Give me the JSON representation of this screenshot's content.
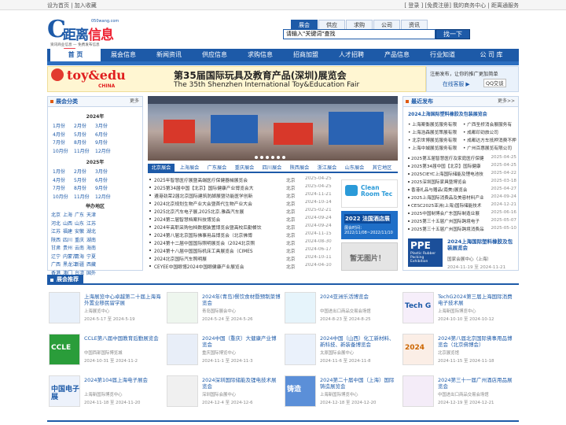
{
  "top": {
    "left": "设为首页 | 加入收藏",
    "right": "[ 登录 ] [免费注册]  我的商务中心 | 距离通服务"
  },
  "logo": {
    "char": "C",
    "title_a": "距离",
    "title_b": "信息网",
    "domain": "050wang.com",
    "slogan": "资讯商业信息 — 免费发布信息"
  },
  "search": {
    "tabs": [
      "展会",
      "供应",
      "求购",
      "公司",
      "资讯"
    ],
    "placeholder": "请输入\"关键词\"查找",
    "button": "找一下"
  },
  "nav": [
    "首 页",
    "展会信息",
    "新闻资讯",
    "供应信息",
    "求购信息",
    "招商加盟",
    "人才招聘",
    "产品信息",
    "行业知道",
    "公 司 库"
  ],
  "banner": {
    "logo_a": "toy&edu",
    "logo_b": "CHINA",
    "cn": "第35届国际玩具及教育产品(深圳)展览会",
    "en": "The 35th Shenzhen International Toy&Education Fair"
  },
  "reg": {
    "text": "注册发布，让你的推广更加简单",
    "link": "在线客服 ▶",
    "qq": "QQ交谈"
  },
  "category": {
    "title": "展会分类",
    "more": "更多",
    "y2024": "2024年",
    "months2024": [
      "1月份",
      "2月份",
      "3月份",
      "4月份",
      "5月份",
      "6月份",
      "7月份",
      "8月份",
      "9月份",
      "10月份",
      "11月份",
      "12月份"
    ],
    "y2025": "2025年",
    "months2025": [
      "1月份",
      "2月份",
      "3月份",
      "4月份",
      "5月份",
      "6月份",
      "7月份",
      "8月份",
      "9月份",
      "10月份",
      "11月份",
      "12月份"
    ],
    "region_title": "举办地区",
    "regions": [
      "北京",
      "上海",
      "广东",
      "天津",
      "河北",
      "山西",
      "山东",
      "江苏",
      "江苏",
      "福建",
      "安徽",
      "湖北",
      "陕西",
      "四川",
      "重庆",
      "湖南",
      "甘肃",
      "贵州",
      "云南",
      "海南",
      "辽宁",
      "内蒙古",
      "青海",
      "宁夏",
      "广西",
      "黑龙江",
      "新疆",
      "西藏",
      "香港",
      "澳门",
      "台湾",
      "国外"
    ]
  },
  "region_tabs": [
    "北京展会",
    "上海展会",
    "广东展会",
    "重庆展会",
    "四川展会",
    "陕西展会",
    "浙江展会",
    "山东展会",
    "其它地区"
  ],
  "list": [
    {
      "n": "2025年智慧医疗展暨高端医疗保健器械展览会",
      "c": "北京",
      "d": "2025-04-25"
    },
    {
      "n": "2025第34届中国【北京】国际健康产业博览会大",
      "c": "北京",
      "d": "2025-04-25"
    },
    {
      "n": "遵港劲荣2届北京国际建筑防脚展暨功能医学创新",
      "c": "北京",
      "d": "2024-11-21"
    },
    {
      "n": "2024北京规划生物产业大会暨首代生物产业大会",
      "c": "北京",
      "d": "2024-10-14"
    },
    {
      "n": "2025北京汽车电子展,2025北京.雅森汽车展",
      "c": "北京",
      "d": "2025-02-21"
    },
    {
      "n": "2024第二届智慧档案科技博览会",
      "c": "北京",
      "d": "2024-09-24"
    },
    {
      "n": "2024年高职采购包档数据装置博览会暨高校后勤餐饮",
      "c": "北京",
      "d": "2024-09-24"
    },
    {
      "n": "2024第八届北京国际佛事用品博览会（北京佛博",
      "c": "北京",
      "d": "2024-11-15"
    },
    {
      "n": "2024第十二届中国国际照明展览会（2024北京照",
      "c": "北京",
      "d": "2024-08-30"
    },
    {
      "n": "2024第十八届中国国际机床工具展览会（CIMES",
      "c": "北京",
      "d": "2024-06-17"
    },
    {
      "n": "2024北京国际汽车照明展",
      "c": "北京",
      "d": "2024-10-11"
    },
    {
      "n": "CEYEE中国眼博2024中国眼健康产业展览会",
      "c": "北京",
      "d": "2024-04-10"
    }
  ],
  "ads": {
    "ad1": "Clean Room Tec",
    "ad2_title": "2022 法国酒店展",
    "ad2_date": "展会时间：2022/11/08~2022/11/10",
    "ad3": "暂无图片！"
  },
  "latest": {
    "title": "最近发布",
    "more": "更多>>",
    "sub": "2024上海国际塑料橡胶及包装展览会",
    "grid": [
      "上海案衡展览服务有限",
      "广西圣桥消会展服务有",
      "上海浩森展览策展有限",
      "成都印劲旅公司",
      "北京世博展览服务有限",
      "成都达方车抵押消费不押",
      "上海中城展览服务有限",
      "广州百惠展览有限公司"
    ],
    "rows": [
      {
        "n": "2025第五届智慧医疗及家庭医疗保健",
        "d": "2025-04-25"
      },
      {
        "n": "2025第34届中国【北京】国际健康",
        "d": "2025-04-25"
      },
      {
        "n": "2025CIEYC上海国际储能及锂电池技",
        "d": "2025-04-22"
      },
      {
        "n": "2025深圳国际家具暨博览会",
        "d": "2025-03-18"
      },
      {
        "n": "香港礼品与赠品(南美)展览会",
        "d": "2025-04-27"
      },
      {
        "n": "2025上海国际消费品及美容材料产业",
        "d": "2024-09-24"
      },
      {
        "n": "CESC2025亚洲(上海)国际储能技术",
        "d": "2024-12-21"
      },
      {
        "n": "2025中国制博会广东国际制造业展",
        "d": "2025-06-16"
      },
      {
        "n": "2025第三十五届广州国际跨境电子",
        "d": "2025-05-07"
      },
      {
        "n": "2025第三十五届广州国际跨境消费品",
        "d": "2025-05-10"
      }
    ],
    "ppe_a": "PPE",
    "ppe_b": "Plastic Rubber Packing Exhibition",
    "pt": "2024上海国际塑料橡胶及包装展览会",
    "pc": "国家会展中心（上海）",
    "pd": "2024-11-19 至 2024-11-21"
  },
  "rec_title": "展会推荐",
  "cards": [
    {
      "lab": "",
      "t": "上海展览中心卓越第二十届上海海外置业移民留学展",
      "c": "上海展览中心",
      "d": "2024-5-17  至  2024-5-19"
    },
    {
      "lab": "",
      "t": "2024年(青岛)餐饮食材暨预制菜博览会",
      "c": "青岛国际展会中心",
      "d": "2024-5-24  至  2024-5-26"
    },
    {
      "lab": "",
      "t": "2024亚洲乐活博览会",
      "c": "中国进出口商品交易会场馆",
      "d": "2024-8-23  至  2024-8-25"
    },
    {
      "lab": "Tech G",
      "t": "TechG2024第三届上海国际消费电子技术展",
      "c": "上海新国际博览中心",
      "d": "2024-10-10  至  2024-10-12"
    },
    {
      "lab": "CCLE",
      "t": "CCLE第八届中国教育后勤展览会",
      "c": "中国西部国际博览城",
      "d": "2024-10-31  至  2024-11-2"
    },
    {
      "lab": "",
      "t": "2024中国（重庆）大健康产业博览会",
      "c": "重庆国际博览中心",
      "d": "2024-11-1  至  2024-11-3"
    },
    {
      "lab": "",
      "t": "2024中国（山西）化工新材料、新科技、新装备博览会",
      "c": "太原国际会展中心",
      "d": "2024-11-6  至  2024-11-8"
    },
    {
      "lab": "2024",
      "t": "2024第八届北京国际佛事用品博览会（北京佛博会）",
      "c": "北京展览馆",
      "d": "2024-11-15  至  2024-11-18"
    },
    {
      "lab": "中国电子展",
      "t": "2024第104届上海电子展会",
      "c": "上海新国际博览中心",
      "d": "2024-11-18  至  2024-11-20"
    },
    {
      "lab": "",
      "t": "2024深圳国际储能及锂电技术展览会",
      "c": "深圳国际会展中心",
      "d": "2024-12-4  至  2024-12-6"
    },
    {
      "lab": "铸造",
      "t": "2024第二十届中国（上海）国际铸造展览会",
      "c": "上海新国际博览中心",
      "d": "2024-12-18  至  2024-12-20"
    },
    {
      "lab": "",
      "t": "2024第三十一届广州酒店用品展览会",
      "c": "中国进出口商品交易会场馆",
      "d": "2024-12-19  至  2024-12-21"
    }
  ],
  "colors": {
    "primary": "#1d5aa8",
    "accent": "#e05a12"
  }
}
